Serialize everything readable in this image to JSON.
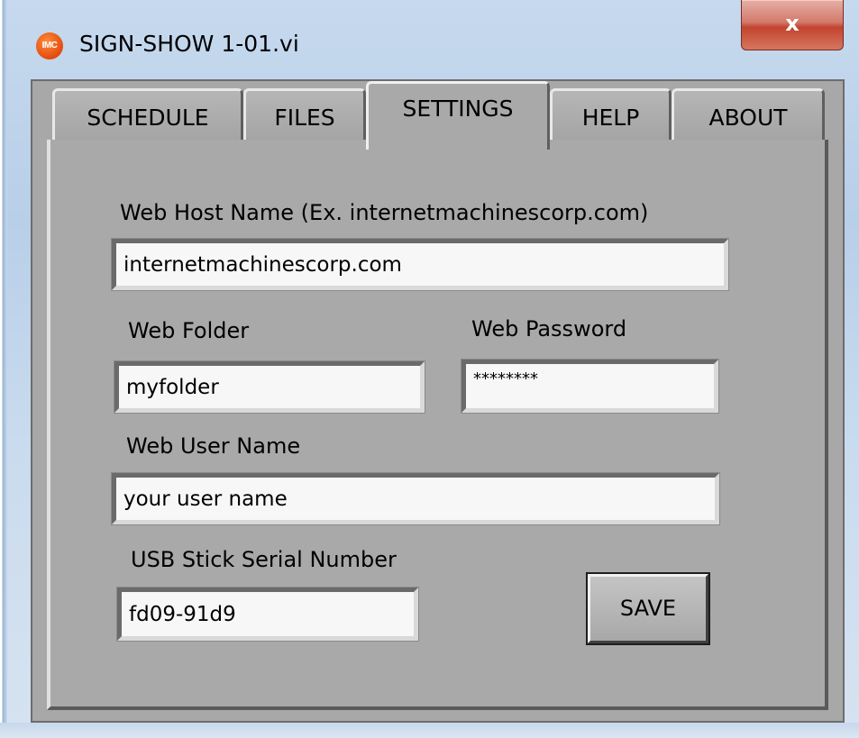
{
  "window": {
    "title": "SIGN-SHOW 1-01.vi",
    "app_icon_text": "IMC",
    "close_glyph": "x"
  },
  "tabs": [
    {
      "label": "SCHEDULE",
      "active": false
    },
    {
      "label": "FILES",
      "active": false
    },
    {
      "label": "SETTINGS",
      "active": true
    },
    {
      "label": "HELP",
      "active": false
    },
    {
      "label": "ABOUT",
      "active": false
    }
  ],
  "settings": {
    "web_host": {
      "label": "Web Host Name  (Ex. internetmachinescorp.com)",
      "value": "internetmachinescorp.com"
    },
    "web_folder": {
      "label": "Web Folder",
      "value": "myfolder"
    },
    "web_password": {
      "label": "Web Password",
      "value": "********"
    },
    "web_user": {
      "label": "Web User Name",
      "value": "your user name"
    },
    "usb_serial": {
      "label": "USB Stick Serial Number",
      "value": "fd09-91d9"
    },
    "save_label": "SAVE"
  },
  "colors": {
    "panel": "#a9a9a9",
    "close_button": "#c2442f",
    "app_icon": "#e34b0e"
  }
}
